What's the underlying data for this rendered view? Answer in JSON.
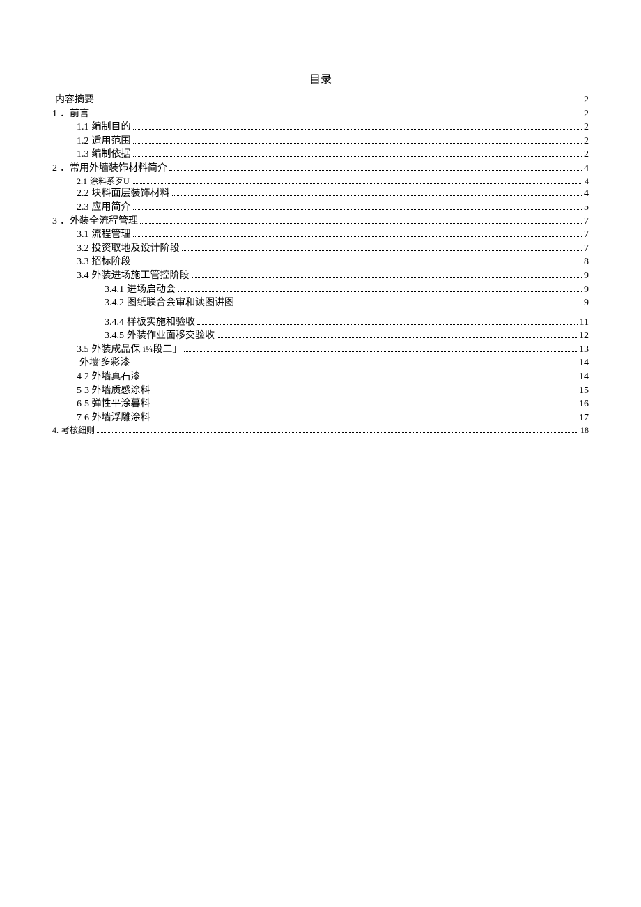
{
  "title": "目录",
  "entries": {
    "e0": {
      "num": "",
      "text": "内容摘要",
      "page": "2"
    },
    "e1": {
      "num": "1",
      "text": "．前言",
      "page": "2"
    },
    "e1_1": {
      "num": "1.1",
      "text": "编制目的",
      "page": "2"
    },
    "e1_2": {
      "num": "1.2",
      "text": "适用范围",
      "page": "2"
    },
    "e1_3": {
      "num": "1.3",
      "text": "编制依据",
      "page": "2"
    },
    "e2": {
      "num": "2",
      "text": "．常用外墙装饰材料简介",
      "page": "4"
    },
    "e2_1": {
      "num": "2.1",
      "text": "涂料系歹U",
      "page": "4"
    },
    "e2_2": {
      "num": "2.2",
      "text": "块料面层装饰材料",
      "page": "4"
    },
    "e2_3": {
      "num": "2.3",
      "text": "应用简介",
      "page": "5"
    },
    "e3": {
      "num": "3",
      "text": "．外装全流程管理",
      "page": "7"
    },
    "e3_1": {
      "num": "3.1",
      "text": "流程管理",
      "page": "7"
    },
    "e3_2": {
      "num": "3.2",
      "text": "投资取地及设计阶段",
      "page": "7"
    },
    "e3_3": {
      "num": "3.3",
      "text": "招标阶段",
      "page": "8"
    },
    "e3_4": {
      "num": "3.4",
      "text": "外装进场施工管控阶段",
      "page": "9"
    },
    "e3_4_1": {
      "num": "3.4.1",
      "text": "进场启动会",
      "page": "9"
    },
    "e3_4_2": {
      "num": "3.4.2",
      "text": "图纸联合会审和读图讲图",
      "page": "9"
    },
    "e3_4_4": {
      "num": "3.4.4",
      "text": "样板实施和验收",
      "page": "11"
    },
    "e3_4_5": {
      "num": "3.4.5",
      "text": "外装作业面移交验收",
      "page": "12"
    },
    "e3_5": {
      "num": "3.5",
      "text": "外装成品保 i¼段二」",
      "page": "13"
    },
    "ex1": {
      "num": "",
      "text": "外墙'多彩漆",
      "page": "14"
    },
    "ex2": {
      "num": "4",
      "text": "2 外墙真石漆",
      "page": "14"
    },
    "ex3": {
      "num": "5",
      "text": "3 外墙质感涂料",
      "page": "15"
    },
    "ex4": {
      "num": "6",
      "text": "5 弹性平涂暮料",
      "page": "16"
    },
    "ex5": {
      "num": "7",
      "text": "6 外墙浮雕涂料",
      "page": "17"
    },
    "e4": {
      "num": "4.",
      "text": "考核细则",
      "page": "18"
    }
  }
}
